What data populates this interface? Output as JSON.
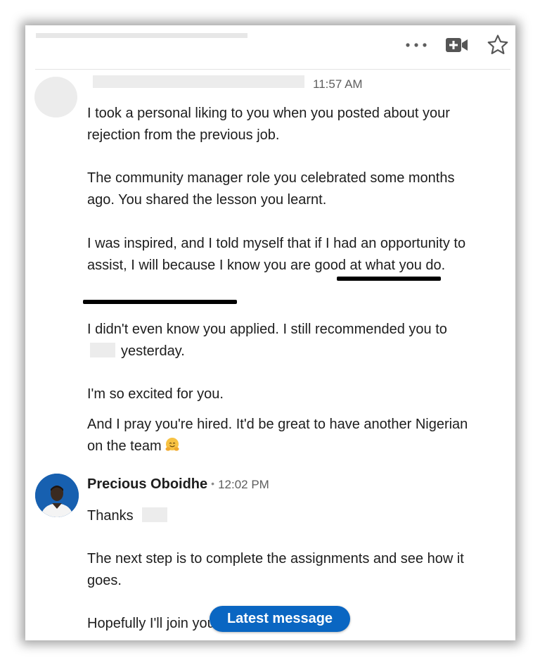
{
  "header": {
    "more_icon": "ellipsis-icon",
    "video_icon": "video-camera-plus-icon",
    "star_icon": "star-icon"
  },
  "message1": {
    "time": "11:57 AM",
    "p1": "I took a personal liking to you when you posted about your rejection from the previous job.",
    "p2": "The community manager role you celebrated some months ago. You shared the lesson you learnt.",
    "p3": "I was inspired, and I told myself that if I had an opportunity to assist, I will because I know you are good at what you do.",
    "p4_a": "I didn't even know you applied. I still recommended you to",
    "p4_b": "yesterday.",
    "p5": "I'm so excited for you.",
    "p6": "And I pray you're hired. It'd be great to have another Nigerian on the team"
  },
  "message2": {
    "sender": "Precious Oboidhe",
    "separator": "•",
    "time": "12:02 PM",
    "p1": "Thanks",
    "p2": "The next step is to complete the assignments and see how it goes.",
    "p3": "Hopefully I'll join you"
  },
  "latest_button": "Latest message"
}
